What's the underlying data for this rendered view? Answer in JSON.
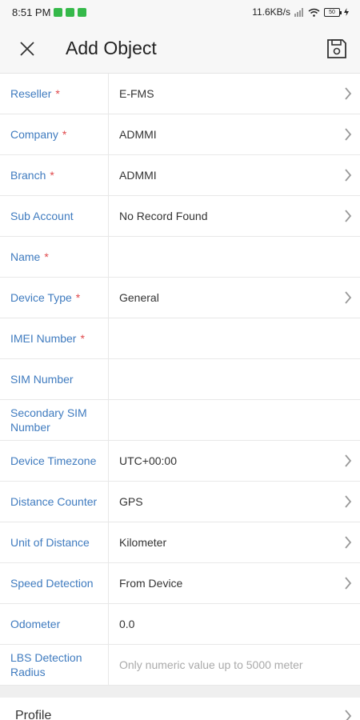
{
  "status_bar": {
    "time": "8:51 PM",
    "network_speed": "11.6KB/s",
    "battery": "50"
  },
  "header": {
    "title": "Add Object",
    "close_icon": "close-icon",
    "save_icon": "save-icon"
  },
  "fields": [
    {
      "label": "Reseller",
      "required": "*",
      "value": "E-FMS"
    },
    {
      "label": "Company",
      "required": "*",
      "value": "ADMMI"
    },
    {
      "label": "Branch",
      "required": "*",
      "value": "ADMMI"
    },
    {
      "label": "Sub Account",
      "required": "",
      "value": "No Record Found"
    },
    {
      "label": "Name",
      "required": "*",
      "value": ""
    },
    {
      "label": "Device Type",
      "required": "*",
      "value": "General"
    },
    {
      "label": "IMEI Number",
      "required": "*",
      "value": ""
    },
    {
      "label": "SIM Number",
      "required": "",
      "value": ""
    },
    {
      "label": "Secondary SIM Number",
      "required": "",
      "value": ""
    },
    {
      "label": "Device Timezone",
      "required": "",
      "value": "UTC+00:00"
    },
    {
      "label": "Distance Counter",
      "required": "",
      "value": "GPS"
    },
    {
      "label": "Unit of Distance",
      "required": "",
      "value": "Kilometer"
    },
    {
      "label": "Speed Detection",
      "required": "",
      "value": "From Device"
    },
    {
      "label": "Odometer",
      "required": "",
      "value": "0.0"
    },
    {
      "label": "LBS Detection Radius",
      "required": "",
      "placeholder": "Only numeric value up to 5000 meter"
    }
  ],
  "profile": {
    "label": "Profile"
  }
}
